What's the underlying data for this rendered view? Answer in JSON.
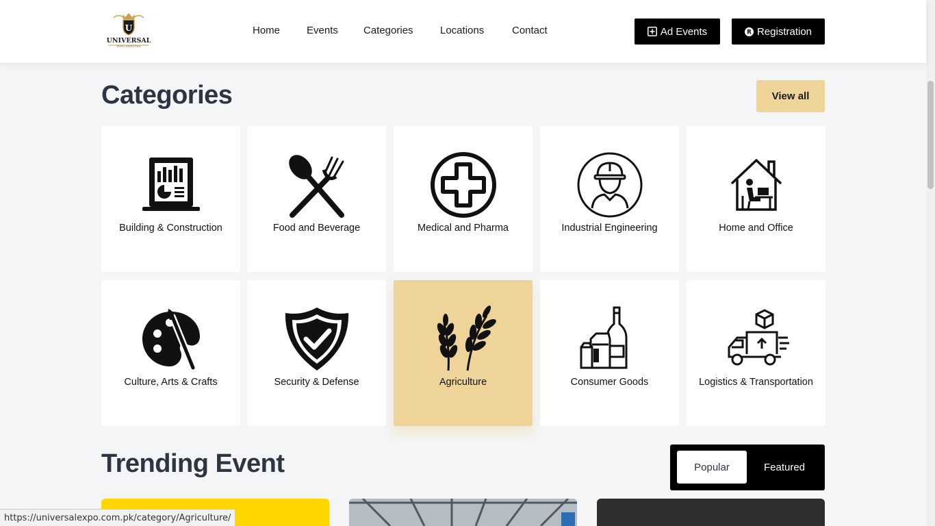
{
  "header": {
    "logo_text": "UNIVERSAL",
    "logo_sub": "EXPO SERVICES",
    "nav": [
      "Home",
      "Events",
      "Categories",
      "Locations",
      "Contact"
    ],
    "ad_events_label": "Ad Events",
    "registration_label": "Registration"
  },
  "categories": {
    "title": "Categories",
    "view_all_label": "View all",
    "items": [
      {
        "label": "Building & Construction",
        "icon": "building-report-icon"
      },
      {
        "label": "Food and Beverage",
        "icon": "spoon-fork-icon"
      },
      {
        "label": "Medical and Pharma",
        "icon": "medical-cross-icon"
      },
      {
        "label": "Industrial Engineering",
        "icon": "engineer-icon"
      },
      {
        "label": "Home and Office",
        "icon": "home-office-icon"
      },
      {
        "label": "Culture, Arts & Crafts",
        "icon": "palette-icon"
      },
      {
        "label": "Security & Defense",
        "icon": "shield-check-icon"
      },
      {
        "label": "Agriculture",
        "icon": "wheat-icon",
        "active": true
      },
      {
        "label": "Consumer Goods",
        "icon": "consumer-goods-icon"
      },
      {
        "label": "Logistics & Transportation",
        "icon": "delivery-truck-icon"
      }
    ]
  },
  "trending": {
    "title": "Trending Event",
    "tabs": [
      "Popular",
      "Featured"
    ],
    "active_tab": "Popular"
  },
  "status_bar": {
    "url": "https://universalexpo.com.pk/category/Agriculture/"
  },
  "colors": {
    "accent": "#eed498",
    "title": "#2d3542",
    "dark": "#000000"
  }
}
